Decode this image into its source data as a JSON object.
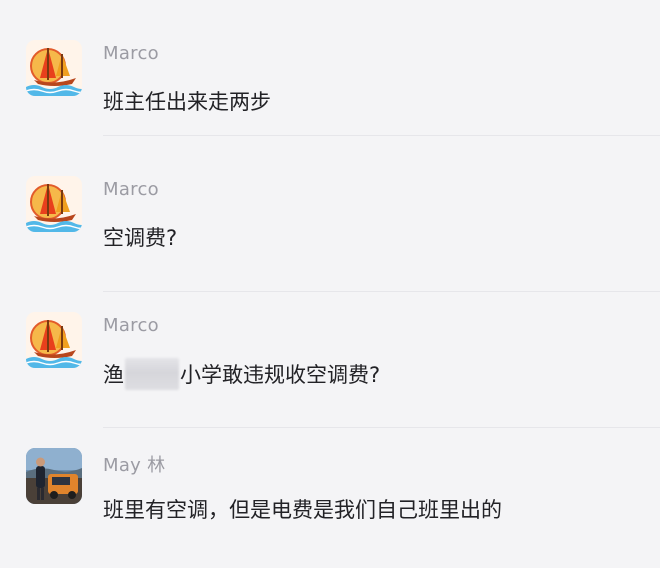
{
  "messages": [
    {
      "sender": "Marco",
      "avatar": "sailboat-avatar",
      "parts": [
        "班主任出来走两步"
      ]
    },
    {
      "sender": "Marco",
      "avatar": "sailboat-avatar",
      "parts": [
        "空调费?"
      ]
    },
    {
      "sender": "Marco",
      "avatar": "sailboat-avatar",
      "parts": [
        "渔",
        "小学敢违规收空调费?"
      ]
    },
    {
      "sender": "May 林",
      "avatar": "photo-avatar",
      "parts": [
        "班里有空调，但是电费是我们自己班里出的"
      ]
    }
  ],
  "colors": {
    "background": "#f4f4f6",
    "sender_name": "#9b9ba3",
    "message_text": "#222226",
    "divider": "#e6e6ea"
  }
}
